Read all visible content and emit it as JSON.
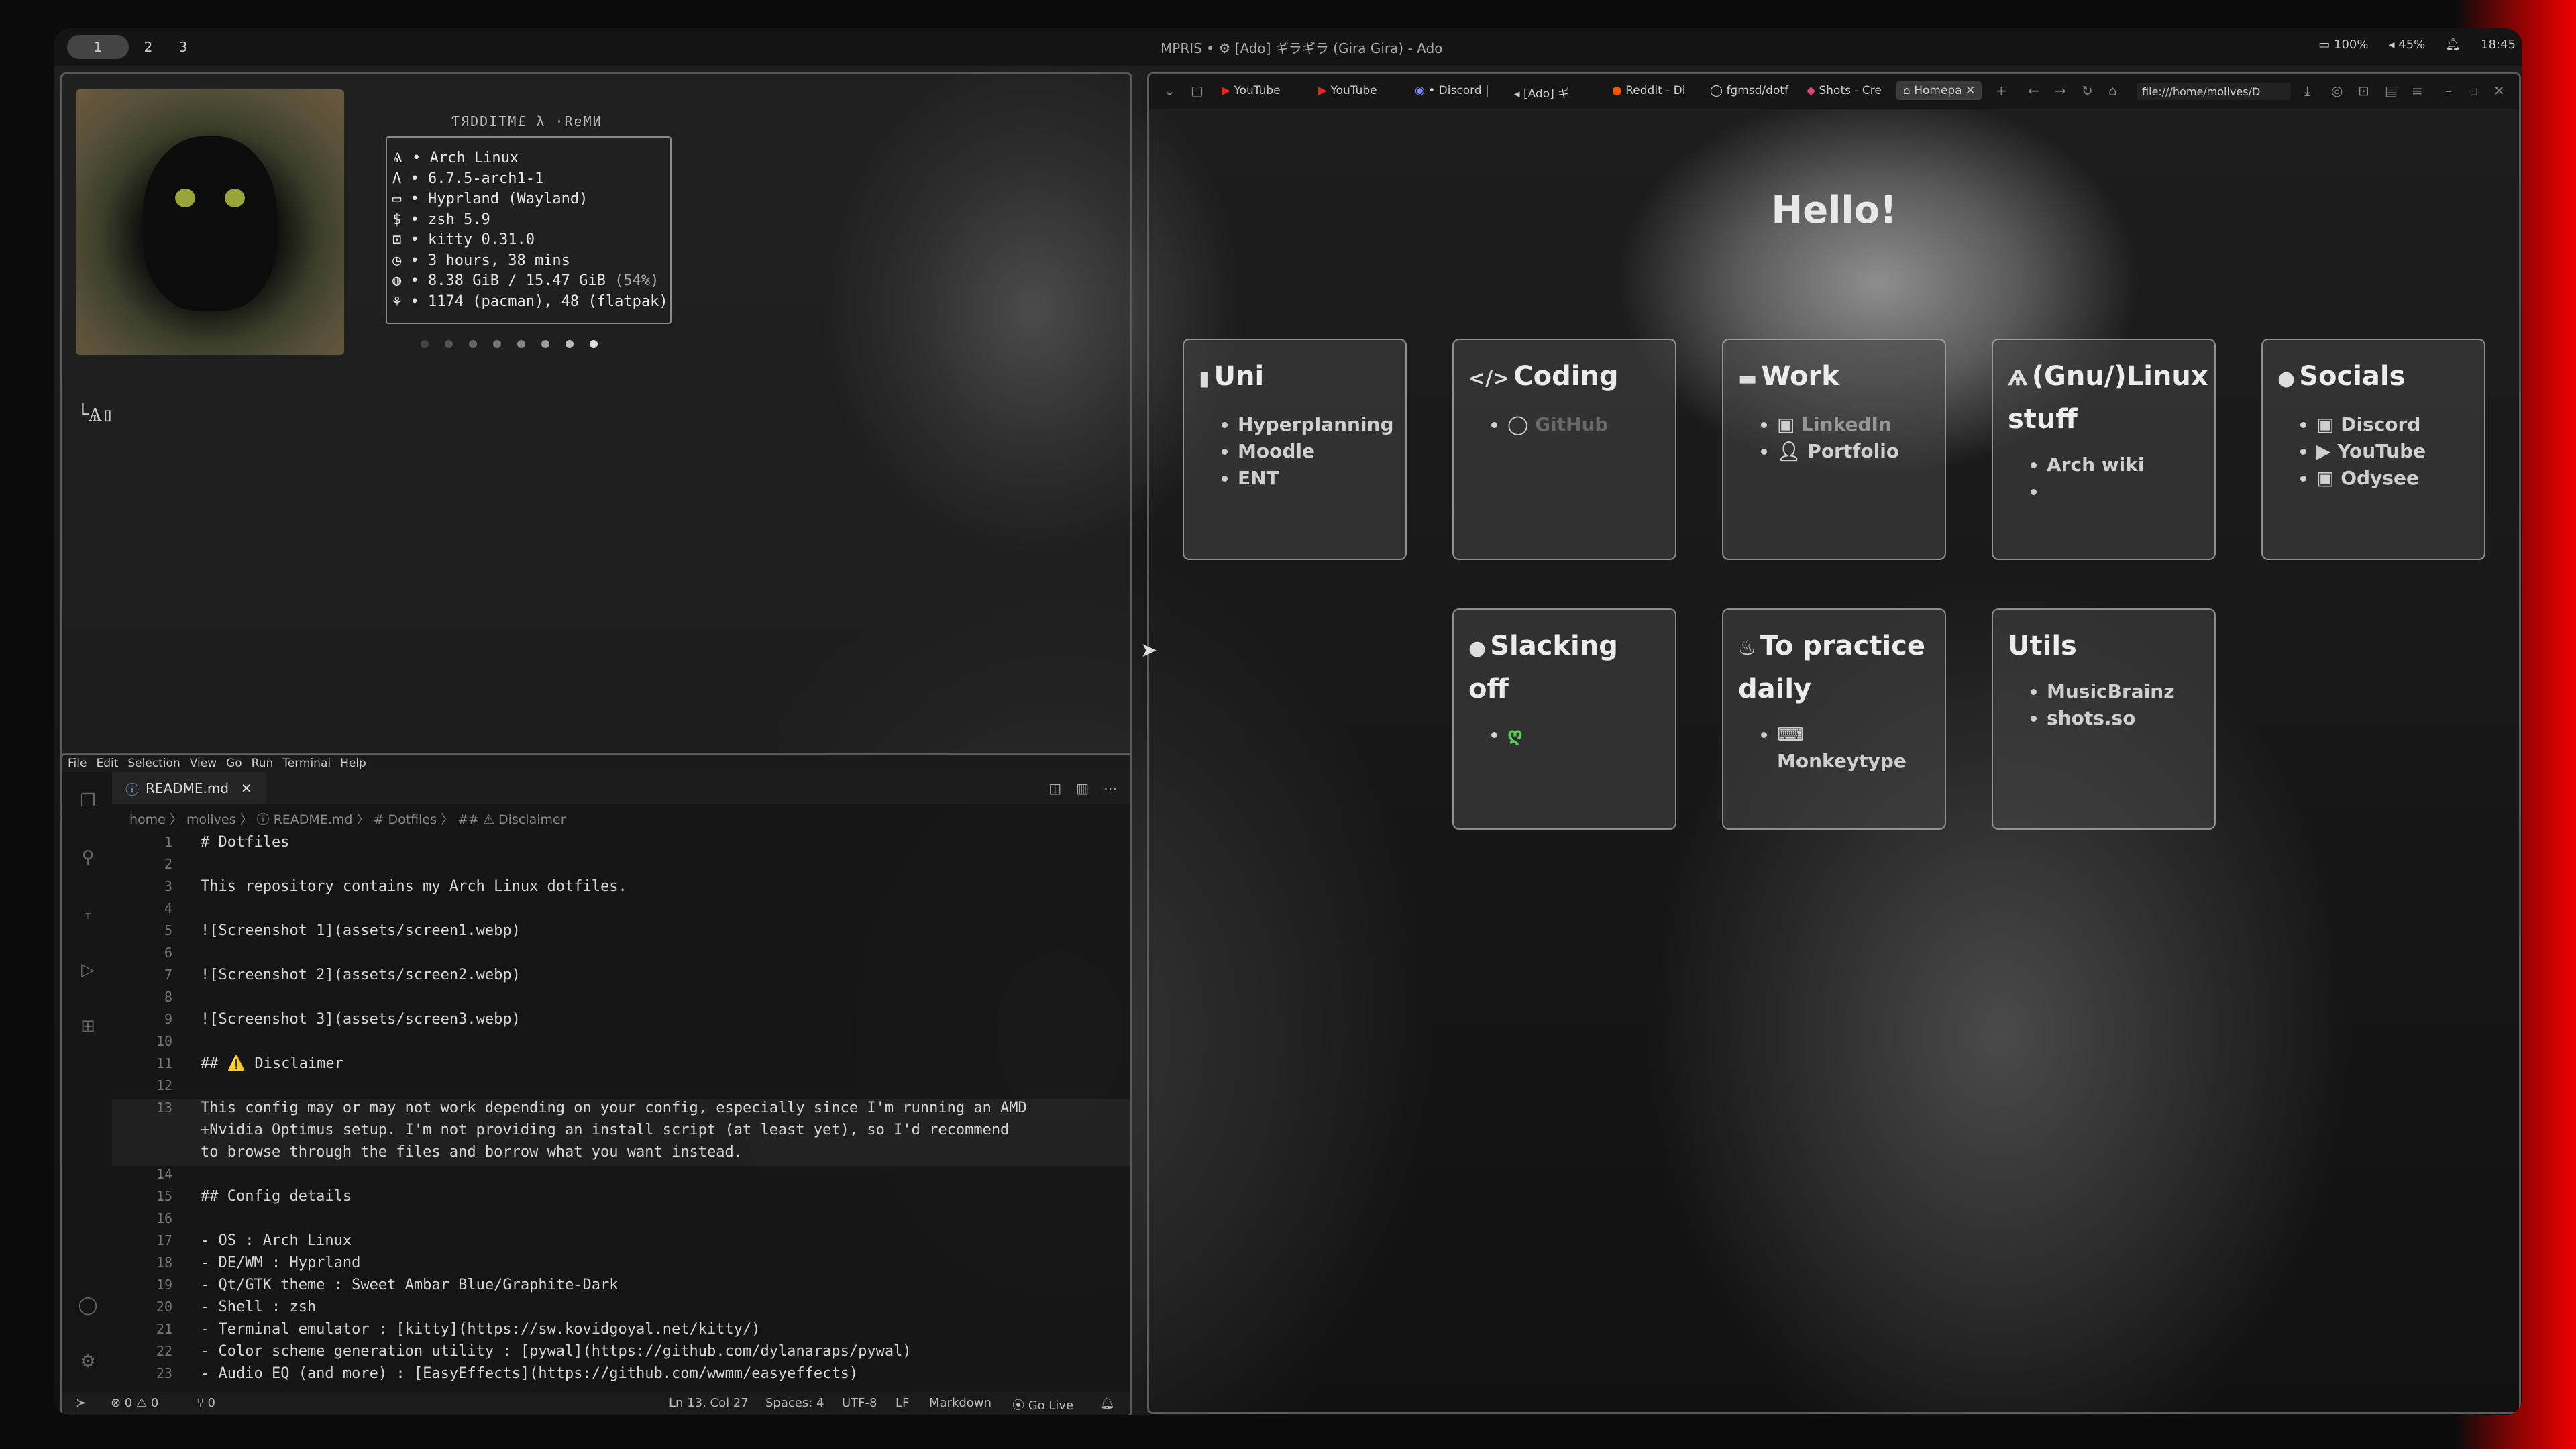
{
  "topbar": {
    "workspaces": [
      "1",
      "2",
      "3"
    ],
    "mpris": "MPRIS • ⚙  [Ado] ギラギラ (Gira Gira) - Ado",
    "battery": "100%",
    "volume": "45%",
    "clock": "18:45"
  },
  "kitty": {
    "title": "ƬЯDDITM£ λ ·RɐMИ",
    "lines": [
      {
        "icon": "Ѧ",
        "text": "Arch Linux",
        "sub": ""
      },
      {
        "icon": "Λ",
        "text": "6.7.5-arch1-1",
        "sub": ""
      },
      {
        "icon": "▭",
        "text": "Hyprland (Wayland)",
        "sub": ""
      },
      {
        "icon": "$",
        "text": "zsh 5.9",
        "sub": ""
      },
      {
        "icon": "⊡",
        "text": "kitty 0.31.0",
        "sub": ""
      },
      {
        "icon": "◷",
        "text": "3 hours, 38 mins",
        "sub": ""
      },
      {
        "icon": "◍",
        "text": "8.38 GiB / 15.47 GiB",
        "sub": "(54%)"
      },
      {
        "icon": "⚘",
        "text": "1174 (pacman), 48 (flatpak)",
        "sub": ""
      }
    ],
    "prompt": "└Ѧ▯",
    "colors": [
      "#444444",
      "#555555",
      "#666666",
      "#777777",
      "#888888",
      "#999999",
      "#bbbbbb",
      "#dddddd"
    ]
  },
  "vscode": {
    "menu": [
      "File",
      "Edit",
      "Selection",
      "View",
      "Go",
      "Run",
      "Terminal",
      "Help"
    ],
    "tab": "README.md",
    "breadcrumb": "home 〉 molives 〉 ⓘ README.md 〉 # Dotfiles 〉 ## ⚠ Disclaimer",
    "lines": [
      {
        "n": "1",
        "t": "# Dotfiles"
      },
      {
        "n": "2",
        "t": ""
      },
      {
        "n": "3",
        "t": "This repository contains my Arch Linux dotfiles."
      },
      {
        "n": "4",
        "t": ""
      },
      {
        "n": "5",
        "t": "![Screenshot 1](assets/screen1.webp)"
      },
      {
        "n": "6",
        "t": ""
      },
      {
        "n": "7",
        "t": "![Screenshot 2](assets/screen2.webp)"
      },
      {
        "n": "8",
        "t": ""
      },
      {
        "n": "9",
        "t": "![Screenshot 3](assets/screen3.webp)"
      },
      {
        "n": "10",
        "t": ""
      },
      {
        "n": "11",
        "t": "## ⚠️ Disclaimer"
      },
      {
        "n": "12",
        "t": ""
      },
      {
        "n": "13",
        "t": "This config may or may not work depending on your config, especially since I'm running an AMD"
      },
      {
        "n": "",
        "t": "+Nvidia Optimus setup. I'm not providing an install script (at least yet), so I'd recommend"
      },
      {
        "n": "",
        "t": "to browse through the files and borrow what you want instead."
      },
      {
        "n": "14",
        "t": ""
      },
      {
        "n": "15",
        "t": "## Config details"
      },
      {
        "n": "16",
        "t": ""
      },
      {
        "n": "17",
        "t": "- OS : Arch Linux"
      },
      {
        "n": "18",
        "t": "- DE/WM : Hyprland"
      },
      {
        "n": "19",
        "t": "- Qt/GTK theme : Sweet Ambar Blue/Graphite-Dark"
      },
      {
        "n": "20",
        "t": "- Shell : zsh"
      },
      {
        "n": "21",
        "t": "- Terminal emulator : [kitty](https://sw.kovidgoyal.net/kitty/)"
      },
      {
        "n": "22",
        "t": "- Color scheme generation utility : [pywal](https://github.com/dylanaraps/pywal)"
      },
      {
        "n": "23",
        "t": "- Audio EQ (and more) : [EasyEffects](https://github.com/wwmm/easyeffects)"
      }
    ],
    "status": {
      "problems": "⊗ 0 ⚠ 0",
      "ports": "⑂ 0",
      "cursor": "Ln 13, Col 27",
      "spaces": "Spaces: 4",
      "encoding": "UTF-8",
      "eol": "LF",
      "language": "Markdown",
      "golive": "⦿ Go Live"
    }
  },
  "browser": {
    "tabs": [
      {
        "label": "YouTube",
        "icon": "youtube-icon"
      },
      {
        "label": "YouTube",
        "icon": "youtube-icon"
      },
      {
        "label": "• Discord |",
        "icon": "discord-icon"
      },
      {
        "label": "[Ado] ギ",
        "icon": "audio-icon"
      },
      {
        "label": "Reddit - Di",
        "icon": "reddit-icon"
      },
      {
        "label": "fgmsd/dotf",
        "icon": "github-icon"
      },
      {
        "label": "Shots - Cre",
        "icon": "shots-icon"
      },
      {
        "label": "Homepa",
        "icon": "home-icon"
      }
    ],
    "url": "file:///home/molives/D",
    "hello": "Hello!",
    "cards": [
      {
        "title": "Uni",
        "icon": "▮",
        "links": [
          "Hyperplanning",
          "Moodle",
          "ENT"
        ]
      },
      {
        "title": "Coding",
        "icon": "</>",
        "links": [
          "GitHub"
        ]
      },
      {
        "title": "Work",
        "icon": "▬",
        "links": [
          "LinkedIn",
          "Portfolio"
        ]
      },
      {
        "title": "(Gnu/)Linux stuff",
        "icon": "Ѧ",
        "links": [
          "Arch wiki",
          ""
        ]
      },
      {
        "title": "Socials",
        "icon": "●",
        "links": [
          "Discord",
          "YouTube",
          "Odysee"
        ]
      },
      {
        "title": "Slacking off",
        "icon": "●",
        "links": [
          ""
        ]
      },
      {
        "title": "To practice daily",
        "icon": "♨",
        "links": [
          "Monkeytype"
        ]
      },
      {
        "title": "Utils",
        "icon": "",
        "links": [
          "MusicBrainz",
          "shots.so"
        ]
      }
    ]
  }
}
